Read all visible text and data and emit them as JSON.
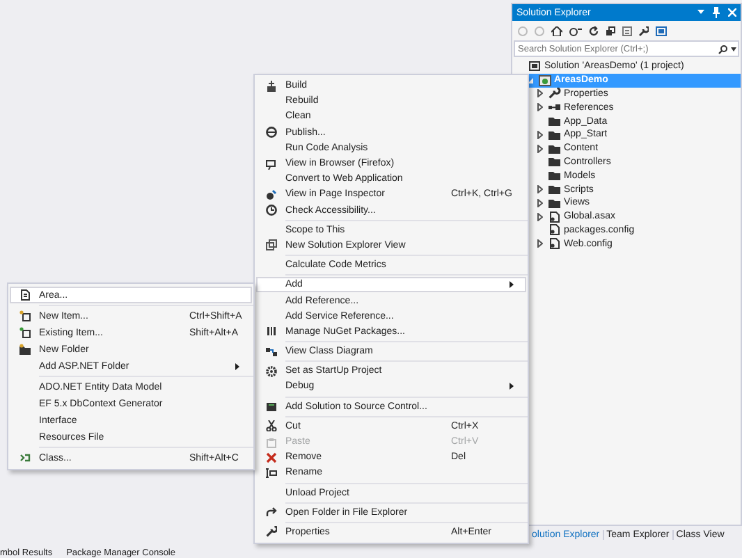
{
  "solution_explorer": {
    "title": "Solution Explorer",
    "search": {
      "placeholder": "Search Solution Explorer (Ctrl+;)"
    },
    "tree": [
      {
        "label": "Solution 'AreasDemo' (1 project)",
        "selected": false,
        "children": [
          {
            "label": "AreasDemo",
            "expanded": true,
            "selected": true,
            "children": [
              {
                "label": "Properties",
                "expanded": false,
                "selected": false
              },
              {
                "label": "References",
                "expanded": false,
                "selected": false
              },
              {
                "label": "App_Data",
                "selected": false
              },
              {
                "label": "App_Start",
                "expanded": false,
                "selected": false
              },
              {
                "label": "Content",
                "expanded": false,
                "selected": false
              },
              {
                "label": "Controllers",
                "selected": false
              },
              {
                "label": "Models",
                "selected": false
              },
              {
                "label": "Scripts",
                "expanded": false,
                "selected": false
              },
              {
                "label": "Views",
                "expanded": false,
                "selected": false
              },
              {
                "label": "Global.asax",
                "expanded": false,
                "selected": false
              },
              {
                "label": "packages.config",
                "selected": false
              },
              {
                "label": "Web.config",
                "expanded": false,
                "selected": false
              }
            ]
          }
        ]
      }
    ]
  },
  "right_tabs": [
    {
      "label": "olution Explorer",
      "selected": true
    },
    {
      "label": "Team Explorer",
      "selected": false
    },
    {
      "label": "Class View",
      "selected": false
    }
  ],
  "bottom_tabs": [
    {
      "label": "mbol Results",
      "selected": false
    },
    {
      "label": "Package Manager Console",
      "selected": false
    }
  ],
  "context_menu": {
    "items": [
      {
        "kind": "item",
        "label": "Build",
        "highlighted": false,
        "disabled": false,
        "has_submenu": false
      },
      {
        "kind": "item",
        "label": "Rebuild",
        "highlighted": false,
        "disabled": false,
        "has_submenu": false
      },
      {
        "kind": "item",
        "label": "Clean",
        "highlighted": false,
        "disabled": false,
        "has_submenu": false
      },
      {
        "kind": "item",
        "label": "Publish...",
        "highlighted": false,
        "disabled": false,
        "has_submenu": false
      },
      {
        "kind": "item",
        "label": "Run Code Analysis",
        "highlighted": false,
        "disabled": false,
        "has_submenu": false
      },
      {
        "kind": "item",
        "label": "View in Browser (Firefox)",
        "highlighted": false,
        "disabled": false,
        "has_submenu": false
      },
      {
        "kind": "item",
        "label": "Convert to Web Application",
        "highlighted": false,
        "disabled": false,
        "has_submenu": false
      },
      {
        "kind": "item",
        "label": "View in Page Inspector",
        "shortcut": "Ctrl+K, Ctrl+G",
        "highlighted": false,
        "disabled": false,
        "has_submenu": false
      },
      {
        "kind": "item",
        "label": "Check Accessibility...",
        "highlighted": false,
        "disabled": false,
        "has_submenu": false
      },
      {
        "kind": "separator"
      },
      {
        "kind": "item",
        "label": "Scope to This",
        "highlighted": false,
        "disabled": false,
        "has_submenu": false
      },
      {
        "kind": "item",
        "label": "New Solution Explorer View",
        "highlighted": false,
        "disabled": false,
        "has_submenu": false
      },
      {
        "kind": "separator"
      },
      {
        "kind": "item",
        "label": "Calculate Code Metrics",
        "highlighted": false,
        "disabled": false,
        "has_submenu": false
      },
      {
        "kind": "separator"
      },
      {
        "kind": "item",
        "label": "Add",
        "highlighted": true,
        "disabled": false,
        "has_submenu": true
      },
      {
        "kind": "item",
        "label": "Add Reference...",
        "highlighted": false,
        "disabled": false,
        "has_submenu": false
      },
      {
        "kind": "item",
        "label": "Add Service Reference...",
        "highlighted": false,
        "disabled": false,
        "has_submenu": false
      },
      {
        "kind": "item",
        "label": "Manage NuGet Packages...",
        "highlighted": false,
        "disabled": false,
        "has_submenu": false
      },
      {
        "kind": "separator"
      },
      {
        "kind": "item",
        "label": "View Class Diagram",
        "highlighted": false,
        "disabled": false,
        "has_submenu": false
      },
      {
        "kind": "separator"
      },
      {
        "kind": "item",
        "label": "Set as StartUp Project",
        "highlighted": false,
        "disabled": false,
        "has_submenu": false
      },
      {
        "kind": "item",
        "label": "Debug",
        "highlighted": false,
        "disabled": false,
        "has_submenu": true
      },
      {
        "kind": "separator"
      },
      {
        "kind": "item",
        "label": "Add Solution to Source Control...",
        "highlighted": false,
        "disabled": false,
        "has_submenu": false
      },
      {
        "kind": "separator"
      },
      {
        "kind": "item",
        "label": "Cut",
        "shortcut": "Ctrl+X",
        "highlighted": false,
        "disabled": false,
        "has_submenu": false
      },
      {
        "kind": "item",
        "label": "Paste",
        "shortcut": "Ctrl+V",
        "highlighted": false,
        "disabled": true,
        "has_submenu": false
      },
      {
        "kind": "item",
        "label": "Remove",
        "shortcut": "Del",
        "highlighted": false,
        "disabled": false,
        "has_submenu": false
      },
      {
        "kind": "item",
        "label": "Rename",
        "highlighted": false,
        "disabled": false,
        "has_submenu": false
      },
      {
        "kind": "separator"
      },
      {
        "kind": "item",
        "label": "Unload Project",
        "highlighted": false,
        "disabled": false,
        "has_submenu": false
      },
      {
        "kind": "separator"
      },
      {
        "kind": "item",
        "label": "Open Folder in File Explorer",
        "highlighted": false,
        "disabled": false,
        "has_submenu": false
      },
      {
        "kind": "separator"
      },
      {
        "kind": "item",
        "label": "Properties",
        "shortcut": "Alt+Enter",
        "highlighted": false,
        "disabled": false,
        "has_submenu": false
      }
    ]
  },
  "add_submenu": {
    "items": [
      {
        "kind": "item",
        "label": "Area...",
        "highlighted": true,
        "disabled": false,
        "has_submenu": false
      },
      {
        "kind": "separator"
      },
      {
        "kind": "item",
        "label": "New Item...",
        "shortcut": "Ctrl+Shift+A",
        "highlighted": false,
        "disabled": false,
        "has_submenu": false
      },
      {
        "kind": "item",
        "label": "Existing Item...",
        "shortcut": "Shift+Alt+A",
        "highlighted": false,
        "disabled": false,
        "has_submenu": false
      },
      {
        "kind": "item",
        "label": "New Folder",
        "highlighted": false,
        "disabled": false,
        "has_submenu": false
      },
      {
        "kind": "item",
        "label": "Add ASP.NET Folder",
        "highlighted": false,
        "disabled": false,
        "has_submenu": true
      },
      {
        "kind": "separator"
      },
      {
        "kind": "item",
        "label": "ADO.NET Entity Data Model",
        "highlighted": false,
        "disabled": false,
        "has_submenu": false
      },
      {
        "kind": "item",
        "label": "EF 5.x DbContext Generator",
        "highlighted": false,
        "disabled": false,
        "has_submenu": false
      },
      {
        "kind": "item",
        "label": "Interface",
        "highlighted": false,
        "disabled": false,
        "has_submenu": false
      },
      {
        "kind": "item",
        "label": "Resources File",
        "highlighted": false,
        "disabled": false,
        "has_submenu": false
      },
      {
        "kind": "separator"
      },
      {
        "kind": "item",
        "label": "Class...",
        "shortcut": "Shift+Alt+C",
        "highlighted": false,
        "disabled": false,
        "has_submenu": false
      }
    ]
  }
}
